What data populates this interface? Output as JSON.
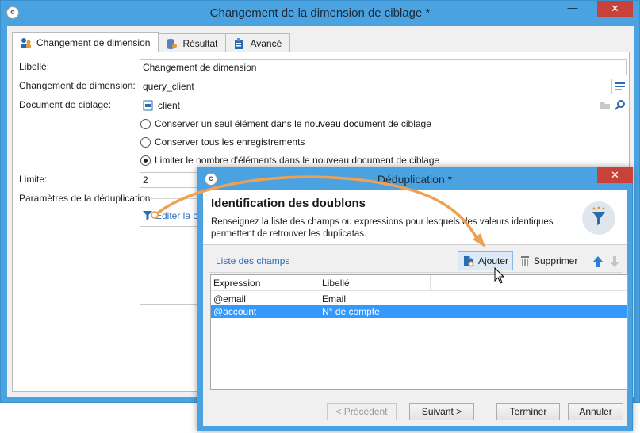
{
  "main_window": {
    "title": "Changement de la dimension de ciblage *",
    "minimize": "—",
    "close": "✕",
    "tabs": [
      {
        "label": "Changement de dimension"
      },
      {
        "label": "Résultat"
      },
      {
        "label": "Avancé"
      }
    ],
    "form": {
      "libelle_label": "Libellé:",
      "libelle_value": "Changement de dimension",
      "dimension_label": "Changement de dimension:",
      "dimension_value": "query_client",
      "document_label": "Document de ciblage:",
      "document_value": "client",
      "radio_options": [
        {
          "label": "Conserver un seul élément dans le nouveau document de ciblage",
          "checked": false
        },
        {
          "label": "Conserver tous les enregistrements",
          "checked": false
        },
        {
          "label": "Limiter le nombre d'éléments dans le nouveau document de ciblage",
          "checked": true
        }
      ],
      "limite_label": "Limite:",
      "limite_value": "2",
      "dedup_section_label": "Paramètres de la déduplication",
      "edit_link": "Editer la c"
    }
  },
  "dedup_dialog": {
    "title": "Déduplication *",
    "close": "✕",
    "header_title": "Identification des doublons",
    "header_desc": "Renseignez la liste des champs ou expressions pour lesquels des valeurs identiques permettent de retrouver les duplicatas.",
    "toolbar": {
      "list_link": "Liste des champs",
      "add_label": "Ajouter",
      "delete_label": "Supprimer"
    },
    "grid": {
      "columns": [
        "Expression",
        "Libellé"
      ],
      "rows": [
        {
          "expression": "@email",
          "label": "Email",
          "selected": false
        },
        {
          "expression": "@account",
          "label": "N° de compte",
          "selected": true
        }
      ]
    },
    "buttons": {
      "previous": "< Précédent",
      "next_letter": "S",
      "next_rest": "uivant >",
      "finish_letter": "T",
      "finish_rest": "erminer",
      "cancel_letter": "A",
      "cancel_rest": "nnuler"
    }
  },
  "colors": {
    "titlebar": "#4aa3e0",
    "accent_orange": "#f0a050",
    "selection": "#3399ff",
    "link": "#2a6ebb"
  }
}
